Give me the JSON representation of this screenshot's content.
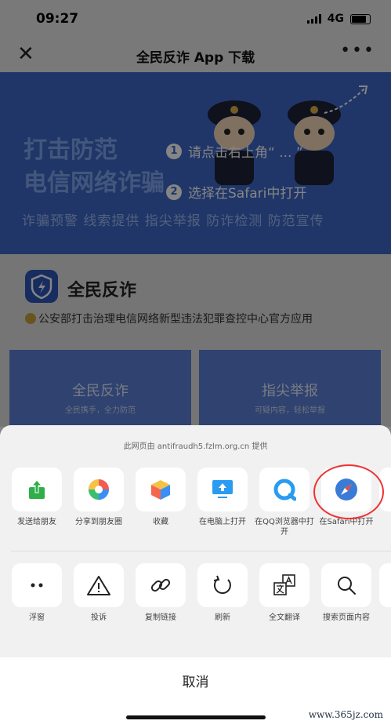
{
  "status_bar": {
    "time": "09:27",
    "network": "4G"
  },
  "nav": {
    "title": "全民反诈 App 下载",
    "close_glyph": "✕",
    "more_glyph": "•••"
  },
  "banner": {
    "headline_1": "打击防范",
    "headline_2": "电信网络诈骗",
    "tags": "诈骗预警  线索提供  指尖举报  防诈检测  防范宣传",
    "step_1_num": "1",
    "step_1": "请点击右上角“ ... ”",
    "step_2_num": "2",
    "step_2": "选择在Safari中打开"
  },
  "app": {
    "name": "全民反诈",
    "description": "公安部打击治理电信网络新型违法犯罪查控中心官方应用"
  },
  "cards": [
    {
      "title": "全民反诈",
      "subtitle": "全民携手，全力防范"
    },
    {
      "title": "指尖举报",
      "subtitle": "可疑内容，轻松举报"
    }
  ],
  "share_sheet": {
    "provider": "此网页由 antifraudh5.fzlm.org.cn 提供",
    "row1": [
      {
        "label": "发送给朋友",
        "icon": "share-to-friend-icon"
      },
      {
        "label": "分享到朋友圈",
        "icon": "moments-icon"
      },
      {
        "label": "收藏",
        "icon": "favorite-cube-icon"
      },
      {
        "label": "在电脑上打开",
        "icon": "computer-icon"
      },
      {
        "label": "在QQ浏览器中打开",
        "icon": "qq-browser-icon"
      },
      {
        "label": "在Safari中打开",
        "icon": "safari-compass-icon"
      }
    ],
    "row2": [
      {
        "label": "浮窗",
        "icon": "float-window-icon"
      },
      {
        "label": "投诉",
        "icon": "warning-icon"
      },
      {
        "label": "复制链接",
        "icon": "link-icon"
      },
      {
        "label": "刷新",
        "icon": "refresh-icon"
      },
      {
        "label": "全文翻译",
        "icon": "translate-icon"
      },
      {
        "label": "搜索页面内容",
        "icon": "search-icon"
      }
    ],
    "cancel_label": "取消"
  },
  "watermark": "www.365jz.com",
  "colors": {
    "accent_blue": "#3f68c8",
    "safari_blue": "#3a7bd5",
    "highlight_red": "#e33333",
    "share_green": "#2fae4a"
  }
}
